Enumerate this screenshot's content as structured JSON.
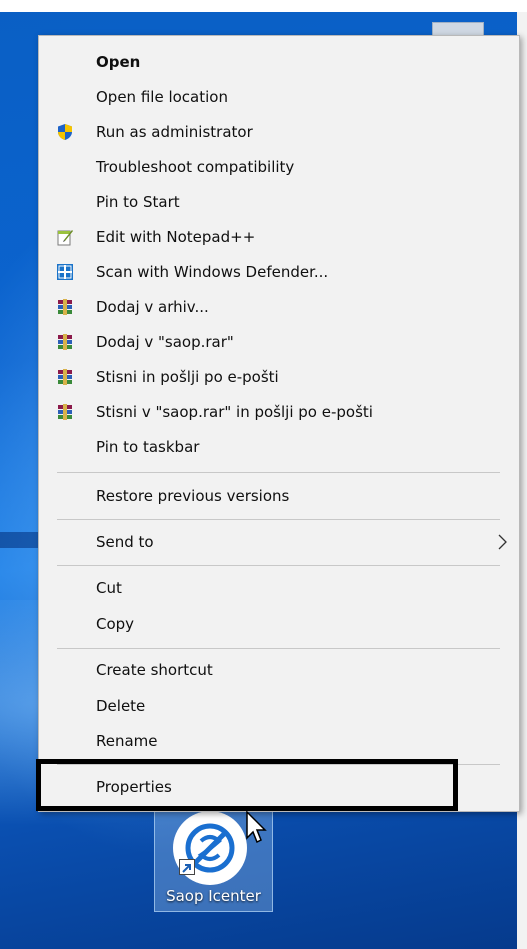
{
  "menu": {
    "items": [
      {
        "label": "Open",
        "bold": true,
        "icon": ""
      },
      {
        "label": "Open file location",
        "icon": ""
      },
      {
        "label": "Run as administrator",
        "icon": "uac-shield-icon"
      },
      {
        "label": "Troubleshoot compatibility",
        "icon": ""
      },
      {
        "label": "Pin to Start",
        "icon": ""
      },
      {
        "label": "Edit with Notepad++",
        "icon": "notepadpp-icon"
      },
      {
        "label": "Scan with Windows Defender...",
        "icon": "windows-defender-icon"
      },
      {
        "label": "Dodaj v arhiv...",
        "icon": "winrar-icon"
      },
      {
        "label": "Dodaj v \"saop.rar\"",
        "icon": "winrar-icon"
      },
      {
        "label": "Stisni in pošlji po e-pošti",
        "icon": "winrar-icon"
      },
      {
        "label": "Stisni v \"saop.rar\" in pošlji po e-pošti",
        "icon": "winrar-icon"
      },
      {
        "label": "Pin to taskbar",
        "icon": ""
      },
      {
        "label": "Restore previous versions",
        "icon": ""
      },
      {
        "label": "Send to",
        "icon": "",
        "submenu": true
      },
      {
        "label": "Cut",
        "icon": ""
      },
      {
        "label": "Copy",
        "icon": ""
      },
      {
        "label": "Create shortcut",
        "icon": ""
      },
      {
        "label": "Delete",
        "icon": ""
      },
      {
        "label": "Rename",
        "icon": ""
      },
      {
        "label": "Properties",
        "icon": "",
        "highlighted": true
      }
    ]
  },
  "desktop": {
    "icon_label": "Saop Icenter",
    "icon_name": "saop-icenter-icon"
  },
  "colors": {
    "menu_bg": "#f2f2f2",
    "desktop_blue": "#0b64d0",
    "highlight_border": "#000000",
    "shield_blue": "#1e63c8",
    "shield_yellow": "#f5c400",
    "defender_blue": "#1a73c9"
  }
}
